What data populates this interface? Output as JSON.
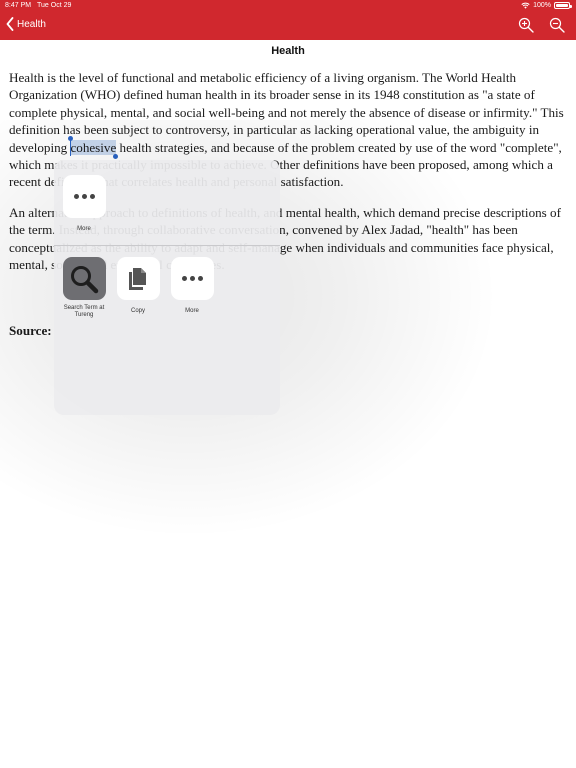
{
  "status_bar": {
    "time": "8:47 PM",
    "date": "Tue Oct 29",
    "battery": "100%"
  },
  "nav": {
    "back_label": "Health",
    "zoom_in_icon": "zoom-in-icon",
    "zoom_out_icon": "zoom-out-icon",
    "bar_color": "#d0282e"
  },
  "document": {
    "title": "Health",
    "p1_a": "Health is the level of functional and metabolic efficiency of a living organism. The World Health Organization (WHO) defined human health in its broader sense in its 1948 constitution as \"a state of complete physical, mental, and social well-being and not merely the absence of disease or infirmity.\" This definition has been subject to controversy, in particular as lacking operational value, the ambiguity in developing ",
    "selected_word": "cohesive",
    "p1_b": " health strategies, and because of the problem created by use of the word \"complete\", which makes it practically impossible to achieve. Other definitions have been proposed, among which a recent definition that correlates health and personal satisfaction.",
    "p2": "An alternative approach to definitions of health, and mental health, which demand precise descriptions of the term. Instead, through collaborative conversation, convened by Alex Jadad, \"health\" has been conceptualized as the ability to adapt and self-manage when individuals and communities face physical, mental, social, and emotional challenges.",
    "source_label": "Source:"
  },
  "share_sheet": {
    "row1": [
      {
        "label": "More",
        "icon": "more-dots-icon"
      }
    ],
    "row2": [
      {
        "label": "Search Term at Tureng",
        "icon": "magnifier-icon"
      },
      {
        "label": "Copy",
        "icon": "copy-icon"
      },
      {
        "label": "More",
        "icon": "more-dots-icon"
      }
    ]
  }
}
